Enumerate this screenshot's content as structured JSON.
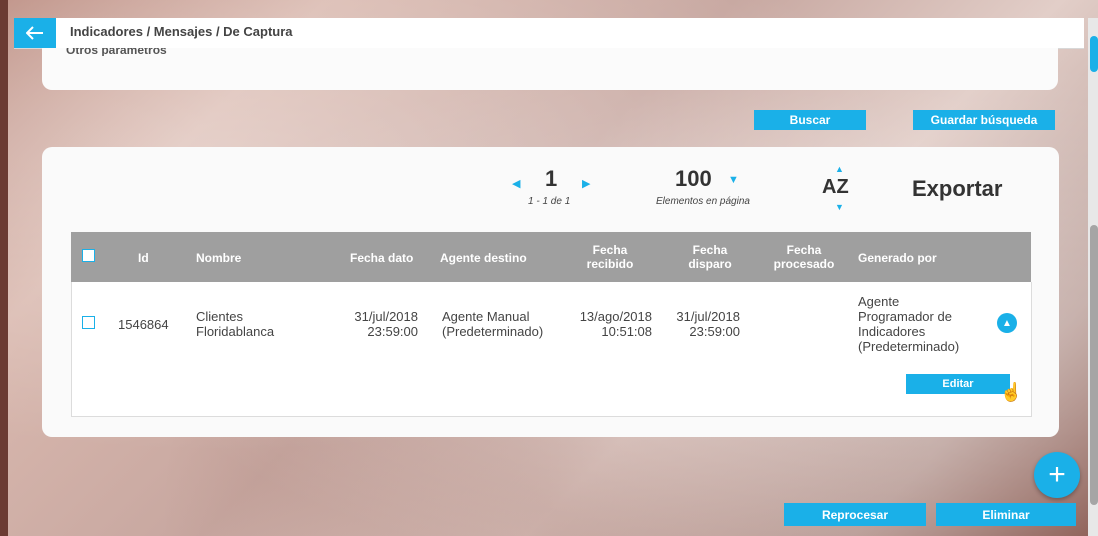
{
  "header": {
    "breadcrumb": "Indicadores / Mensajes / De Captura",
    "back_icon": "arrow-left-icon"
  },
  "filters": {
    "otros_parametros": "Otros parámetros"
  },
  "search_actions": {
    "buscar": "Buscar",
    "guardar_busqueda": "Guardar búsqueda"
  },
  "pagination": {
    "page": "1",
    "range": "1 - 1 de 1",
    "per_page": "100",
    "per_page_label": "Elementos en página",
    "sort": "AZ",
    "export": "Exportar"
  },
  "table": {
    "headers": {
      "id": "Id",
      "nombre": "Nombre",
      "fecha_dato": "Fecha dato",
      "agente_destino": "Agente destino",
      "fecha_recibido_1": "Fecha",
      "fecha_recibido_2": "recibido",
      "fecha_disparo_1": "Fecha",
      "fecha_disparo_2": "disparo",
      "fecha_procesado_1": "Fecha",
      "fecha_procesado_2": "procesado",
      "generado_por": "Generado por"
    },
    "rows": [
      {
        "id": "1546864",
        "nombre_1": "Clientes",
        "nombre_2": "Floridablanca",
        "fecha_dato_1": "31/jul/2018",
        "fecha_dato_2": "23:59:00",
        "agente_1": "Agente Manual",
        "agente_2": "(Predeterminado)",
        "recibido_1": "13/ago/2018",
        "recibido_2": "10:51:08",
        "disparo_1": "31/jul/2018",
        "disparo_2": "23:59:00",
        "procesado": "",
        "generado_1": "Agente",
        "generado_2": "Programador de",
        "generado_3": "Indicadores",
        "generado_4": "(Predeterminado)",
        "edit_label": "Editar"
      }
    ]
  },
  "bottom_actions": {
    "reprocesar": "Reprocesar",
    "eliminar": "Eliminar"
  },
  "colors": {
    "accent": "#1ab0e8",
    "table_header": "#9f9f9f"
  }
}
